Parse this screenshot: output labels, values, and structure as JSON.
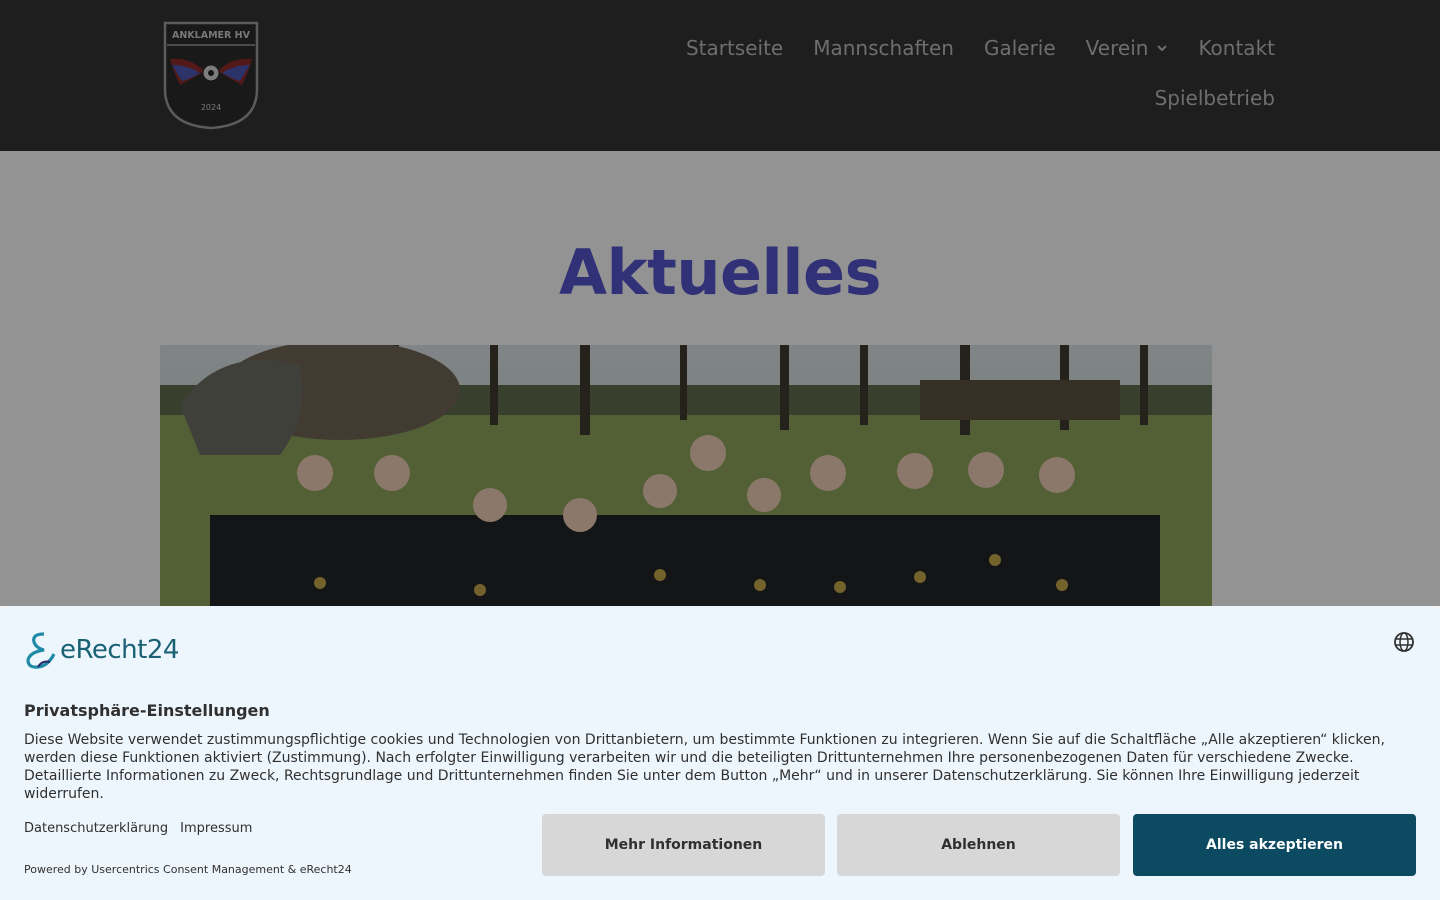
{
  "logo": {
    "club_name": "ANKLAMER HV",
    "year": "2024"
  },
  "nav": {
    "row1": [
      {
        "label": "Startseite"
      },
      {
        "label": "Mannschaften"
      },
      {
        "label": "Galerie"
      },
      {
        "label": "Verein",
        "has_dropdown": true
      },
      {
        "label": "Kontakt"
      }
    ],
    "row2": [
      {
        "label": "Spielbetrieb"
      }
    ]
  },
  "page": {
    "title": "Aktuelles"
  },
  "colors": {
    "header_bg": "#333333",
    "title": "#5353c8",
    "consent_bg": "#eef6fd",
    "accept_button": "#0b4a61",
    "secondary_button": "#d7d7d7"
  },
  "consent": {
    "brand": "eRecht24",
    "title": "Privatsphäre-Einstellungen",
    "text": "Diese Website verwendet zustimmungspflichtige cookies und Technologien von Drittanbietern, um bestimmte Funktionen zu integrieren. Wenn Sie auf die Schaltfläche „Alle akzeptieren“ klicken, werden diese Funktionen aktiviert (Zustimmung). Nach erfolgter Einwilligung verarbeiten wir und die beteiligten Drittunternehmen Ihre personenbezogenen Daten für verschiedene Zwecke. Detaillierte Informationen zu Zweck, Rechtsgrundlage und Drittunternehmen finden Sie unter dem Button „Mehr“ und in unserer Datenschutzerklärung. Sie können Ihre Einwilligung jederzeit widerrufen.",
    "link_privacy": "Datenschutzerklärung",
    "link_imprint": "Impressum",
    "powered_by": "Powered by Usercentrics Consent Management & eRecht24",
    "btn_more": "Mehr Informationen",
    "btn_decline": "Ablehnen",
    "btn_accept": "Alles akzeptieren",
    "language_icon": "globe-icon"
  }
}
